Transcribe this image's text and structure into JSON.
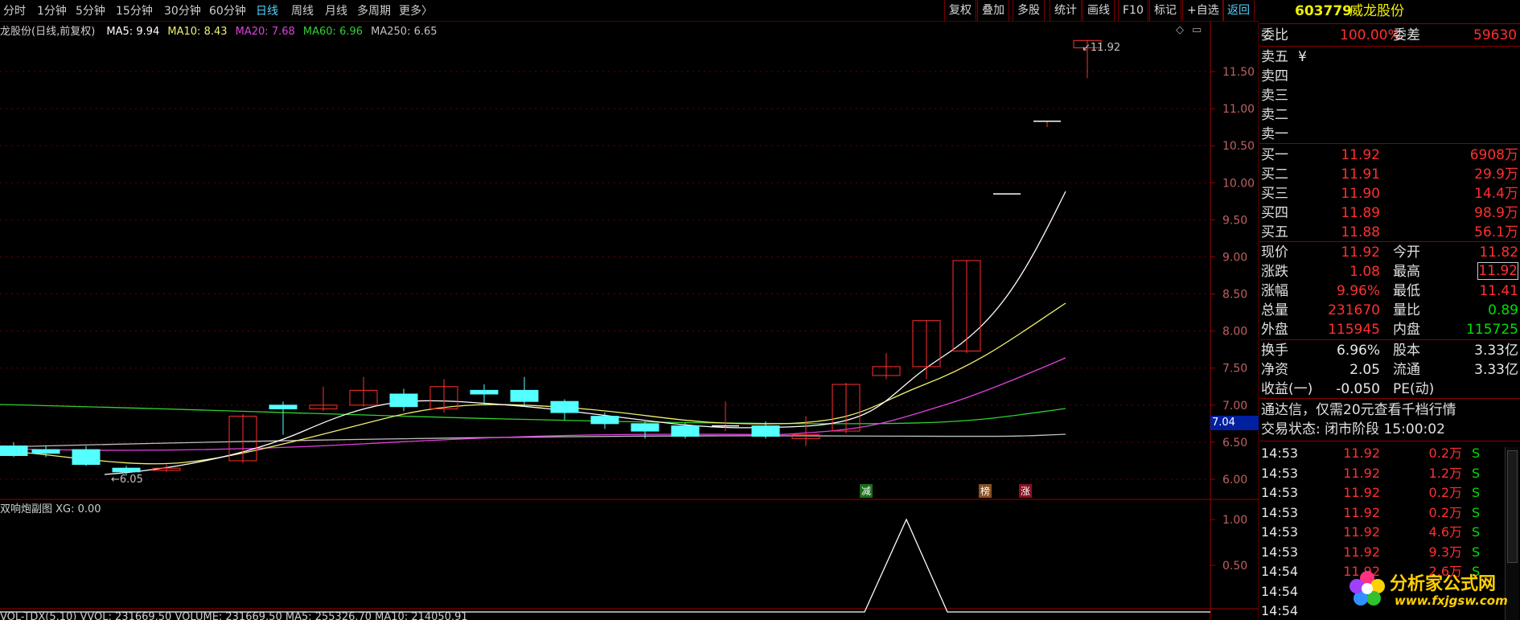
{
  "top": {
    "periods": [
      "分时",
      "1分钟",
      "5分钟",
      "15分钟",
      "30分钟",
      "60分钟",
      "日线",
      "周线",
      "月线",
      "多周期",
      "更多〉"
    ],
    "active": "日线",
    "buttons": [
      "复权",
      "叠加",
      "多股",
      "统计",
      "画线",
      "F10",
      "标记",
      "+自选",
      "返回"
    ]
  },
  "ma_legend": {
    "title": "龙股份(日线,前复权)",
    "ma5": "MA5: 9.94",
    "ma10": "MA10: 8.43",
    "ma20": "MA20: 7.68",
    "ma60": "MA60: 6.96",
    "ma250": "MA250: 6.65",
    "colors": {
      "ma5": "#ffffff",
      "ma10": "#f0f070",
      "ma20": "#e040e0",
      "ma60": "#30d030",
      "ma250": "#c0c0c0"
    }
  },
  "chart": {
    "price_ticks": [
      "11.50",
      "11.00",
      "10.50",
      "10.00",
      "9.50",
      "9.00",
      "8.50",
      "8.00",
      "7.50",
      "7.00",
      "6.50",
      "6.00"
    ],
    "current_price_tag": "7.04",
    "high_label": "11.92",
    "low_label": "6.05",
    "signals": [
      "减",
      "榜",
      "涨"
    ],
    "sub_title": "双响炮副图  XG: 0.00",
    "sub_ticks": [
      "1.00",
      "0.50"
    ],
    "bottom_line": "VOL-TDX(5,10)  VVOL: 231669.50  VOLUME: 231669.50  MA5: 255326.70  MA10: 214050.91"
  },
  "quote": {
    "code": "603779",
    "name": "威龙股份",
    "weibi_label": "委比",
    "weibi": "100.00%",
    "weicha_label": "委差",
    "weicha": "59630",
    "sells": [
      {
        "label": "卖五",
        "price": "¥",
        "vol": ""
      },
      {
        "label": "卖四",
        "price": "",
        "vol": ""
      },
      {
        "label": "卖三",
        "price": "",
        "vol": ""
      },
      {
        "label": "卖二",
        "price": "",
        "vol": ""
      },
      {
        "label": "卖一",
        "price": "",
        "vol": ""
      }
    ],
    "buys": [
      {
        "label": "买一",
        "price": "11.92",
        "vol": "6908万"
      },
      {
        "label": "买二",
        "price": "11.91",
        "vol": "29.9万"
      },
      {
        "label": "买三",
        "price": "11.90",
        "vol": "14.4万"
      },
      {
        "label": "买四",
        "price": "11.89",
        "vol": "98.9万"
      },
      {
        "label": "买五",
        "price": "11.88",
        "vol": "56.1万"
      }
    ],
    "stats1": [
      {
        "l1": "现价",
        "v1": "11.92",
        "l2": "今开",
        "v2": "11.82"
      },
      {
        "l1": "涨跌",
        "v1": "1.08",
        "l2": "最高",
        "v2": "11.92"
      },
      {
        "l1": "涨幅",
        "v1": "9.96%",
        "l2": "最低",
        "v2": "11.41"
      },
      {
        "l1": "总量",
        "v1": "231670",
        "l2": "量比",
        "v2": "0.89"
      },
      {
        "l1": "外盘",
        "v1": "115945",
        "l2": "内盘",
        "v2": "115725"
      }
    ],
    "stats2": [
      {
        "l1": "换手",
        "v1": "6.96%",
        "l2": "股本",
        "v2": "3.33亿"
      },
      {
        "l1": "净资",
        "v1": "2.05",
        "l2": "流通",
        "v2": "3.33亿"
      },
      {
        "l1": "收益(一)",
        "v1": "-0.050",
        "l2": "PE(动)",
        "v2": ""
      }
    ],
    "promo": "通达信，仅需20元查看千档行情",
    "status": "交易状态: 闭市阶段 15:00:02",
    "ticks": [
      {
        "t": "14:53",
        "p": "11.92",
        "v": "0.2万",
        "s": "S"
      },
      {
        "t": "14:53",
        "p": "11.92",
        "v": "1.2万",
        "s": "S"
      },
      {
        "t": "14:53",
        "p": "11.92",
        "v": "0.2万",
        "s": "S"
      },
      {
        "t": "14:53",
        "p": "11.92",
        "v": "0.2万",
        "s": "S"
      },
      {
        "t": "14:53",
        "p": "11.92",
        "v": "4.6万",
        "s": "S"
      },
      {
        "t": "14:53",
        "p": "11.92",
        "v": "9.3万",
        "s": "S"
      },
      {
        "t": "14:54",
        "p": "11.92",
        "v": "2.6万",
        "s": "S"
      },
      {
        "t": "14:54",
        "p": "",
        "v": "",
        "s": ""
      },
      {
        "t": "14:54",
        "p": "",
        "v": "",
        "s": ""
      }
    ]
  },
  "logo": {
    "title": "分析家公式网",
    "url": "www.fxjgsw.com"
  }
}
